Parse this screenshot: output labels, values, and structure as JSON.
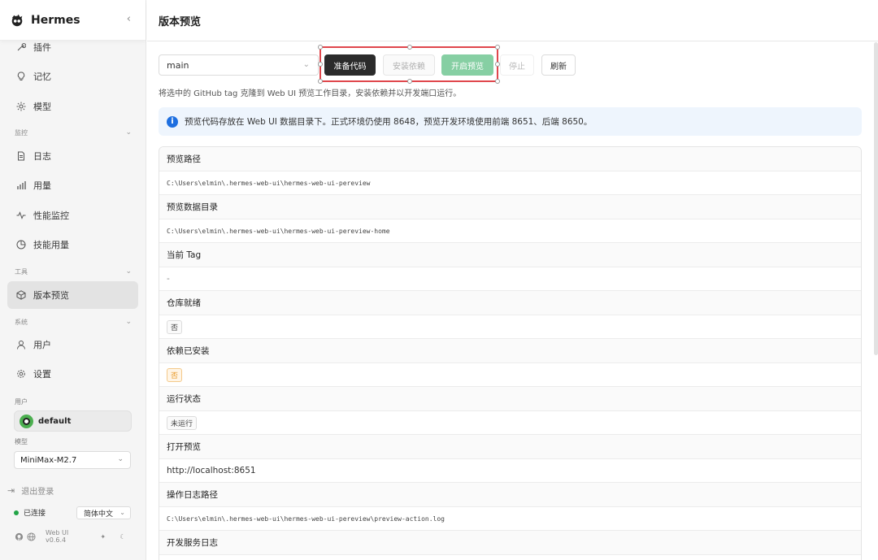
{
  "app": {
    "name": "Hermes"
  },
  "sidebar": {
    "items_top": [
      {
        "label": "插件",
        "icon": "wrench-icon"
      },
      {
        "label": "记忆",
        "icon": "bulb-icon"
      },
      {
        "label": "模型",
        "icon": "sparkle-icon"
      }
    ],
    "group_monitor": "监控",
    "items_monitor": [
      {
        "label": "日志",
        "icon": "file-icon"
      },
      {
        "label": "用量",
        "icon": "bar-chart-icon"
      },
      {
        "label": "性能监控",
        "icon": "pulse-icon"
      },
      {
        "label": "技能用量",
        "icon": "pie-icon"
      }
    ],
    "group_tools": "工具",
    "items_tools": [
      {
        "label": "版本预览",
        "icon": "box-icon",
        "active": true
      }
    ],
    "group_system": "系统",
    "items_system": [
      {
        "label": "用户",
        "icon": "user-icon"
      },
      {
        "label": "设置",
        "icon": "gear-icon"
      }
    ],
    "user_label": "用户",
    "user_name": "default",
    "model_label": "模型",
    "model_value": "MiniMax-M2.7",
    "logout": "退出登录",
    "status": "已连接",
    "status_color": "#22a447",
    "language": "简体中文",
    "version": "Web UI v0.6.4"
  },
  "main": {
    "title": "版本预览",
    "branch": "main",
    "buttons": {
      "prepare": "准备代码",
      "install": "安装依赖",
      "start": "开启预览",
      "stop": "停止",
      "refresh": "刷新"
    },
    "hint": "将选中的 GitHub tag 克隆到 Web UI 预览工作目录，安装依赖并以开发端口运行。",
    "info": "预览代码存放在 Web UI 数据目录下。正式环境仍使用 8648，预览开发环境使用前端 8651、后端 8650。",
    "rows": [
      {
        "label": "预览路径",
        "value": "C:\\Users\\elmin\\.hermes-web-ui\\hermes-web-ui-pereview"
      },
      {
        "label": "预览数据目录",
        "value": "C:\\Users\\elmin\\.hermes-web-ui\\hermes-web-ui-pereview-home"
      },
      {
        "label": "当前 Tag",
        "value": "-"
      },
      {
        "label": "仓库就绪",
        "value": "否"
      },
      {
        "label": "依赖已安装",
        "value": "否"
      },
      {
        "label": "运行状态",
        "value": "未运行"
      },
      {
        "label": "打开预览",
        "value": "http://localhost:8651"
      },
      {
        "label": "操作日志路径",
        "value": "C:\\Users\\elmin\\.hermes-web-ui\\hermes-web-ui-pereview\\preview-action.log"
      },
      {
        "label": "开发服务日志",
        "value": ""
      }
    ]
  }
}
